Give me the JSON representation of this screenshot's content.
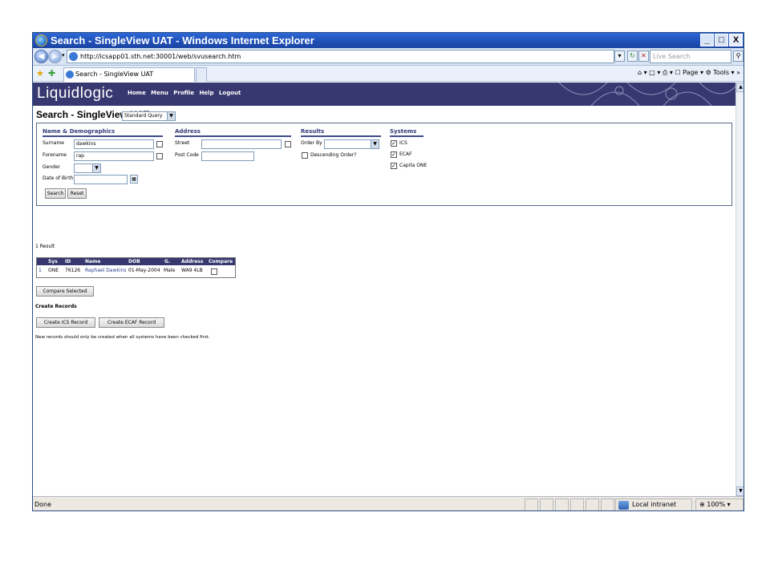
{
  "window": {
    "title": "Search - SingleView UAT - Windows Internet Explorer",
    "minimize": "_",
    "maximize": "□",
    "close": "X"
  },
  "addressbar": {
    "url": "http://icsapp01.sth.net:30001/web/svusearch.htm",
    "search_placeholder": "Live Search"
  },
  "tabbar": {
    "tab_title": "Search - SingleView UAT",
    "tools": "⌂ ▾ □ ▾ ⎙ ▾ ☐ Page ▾ ⚙ Tools ▾ »"
  },
  "app": {
    "logo": "Liquidlogic",
    "menu": [
      "Home",
      "Menu",
      "Profile",
      "Help",
      "Logout"
    ],
    "heading": "Search - SingleView UAT",
    "query_select": "Standard Query"
  },
  "form": {
    "name_demo": {
      "header": "Name & Demographics",
      "surname_label": "Surname",
      "surname_value": "dawkins",
      "forename_label": "Forename",
      "forename_value": "rap",
      "gender_label": "Gender",
      "gender_value": "",
      "dob_label": "Date of Birth",
      "dob_value": ""
    },
    "address": {
      "header": "Address",
      "street_label": "Street",
      "street_value": "",
      "postcode_label": "Post Code",
      "postcode_value": ""
    },
    "results": {
      "header": "Results",
      "orderby_label": "Order By",
      "orderby_value": "",
      "descending_label": "Descending Order?"
    },
    "systems": {
      "header": "Systems",
      "items": [
        {
          "label": "ICS",
          "checked": true
        },
        {
          "label": "ECAF",
          "checked": true
        },
        {
          "label": "Capita ONE",
          "checked": true
        }
      ]
    },
    "search_button": "Search",
    "reset_button": "Reset"
  },
  "results": {
    "count": "1 Result",
    "columns": [
      "Sys",
      "ID",
      "Name",
      "DOB",
      "G.",
      "Address",
      "Compare"
    ],
    "rows": [
      {
        "num": "1",
        "sys": "ONE",
        "id": "76126",
        "name": "Raphael Dawkins",
        "dob": "01-May-2004",
        "gender": "Male",
        "address": "WA9 4LB"
      }
    ],
    "compare_button": "Compare Selected"
  },
  "create": {
    "header": "Create Records",
    "ics_button": "Create ICS Record",
    "ecaf_button": "Create ECAF Record",
    "note": "New records should only be created when all systems have been checked first."
  },
  "status": {
    "text": "Done",
    "zone": "Local intranet",
    "zoom": "100%"
  },
  "colors": {
    "titlebar": "#1f4fb5",
    "banner": "#37386f",
    "section_header": "#2f3a78"
  }
}
